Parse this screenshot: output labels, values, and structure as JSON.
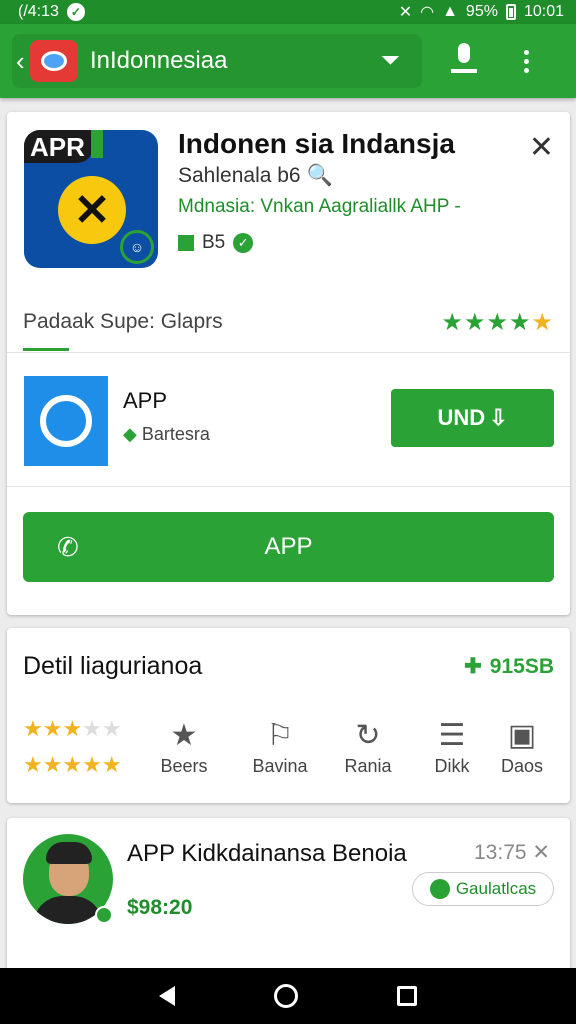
{
  "status_bar": {
    "time_left": "(/4:13",
    "battery": "95%",
    "clock": "10:01"
  },
  "app_bar": {
    "title": "InIdonnesiaa",
    "back_icon": "back-arrow-icon",
    "filter_icon": "funnel-icon",
    "mic_icon": "mic-icon",
    "menu_icon": "kebab-menu-icon"
  },
  "app_card": {
    "badge": "APR",
    "title": "Indonen sia Indansja",
    "subtitle": "Sahlenala b6 🔍",
    "developer": "Mdnasia: Vnkan Aagraliallk AHP -",
    "rating_text": "B5",
    "tab_label": "Padaak Supe: Glaprs",
    "stars": "★★★★",
    "stars_half": "★"
  },
  "sub_app": {
    "title": "APP",
    "meta": "Bartesra",
    "button": "UND"
  },
  "main_button": {
    "label": "APP"
  },
  "details": {
    "title": "Detil liagurianoa",
    "size": "915SB",
    "stats": [
      {
        "label": "Beers"
      },
      {
        "label": "Bavina"
      },
      {
        "label": "Rania"
      },
      {
        "label": "Dikk"
      },
      {
        "label": "Daos"
      }
    ]
  },
  "post": {
    "title": "APP Kidkdainansa Benoia",
    "time": "13:75",
    "price": "$98:20",
    "chip": "Gaulatlcas"
  }
}
